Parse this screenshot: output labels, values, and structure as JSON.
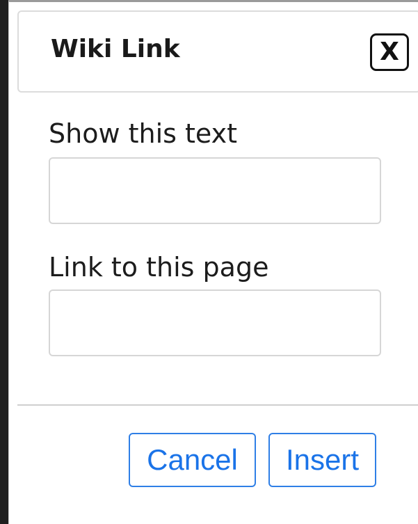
{
  "dialog": {
    "title": "Wiki Link",
    "close_label": "X"
  },
  "form": {
    "show_text_label": "Show this text",
    "show_text_value": "",
    "link_page_label": "Link to this page",
    "link_page_value": ""
  },
  "footer": {
    "cancel_label": "Cancel",
    "insert_label": "Insert"
  },
  "colors": {
    "accent": "#1a73e8",
    "border": "#d6d6d6",
    "text": "#1c1c1c"
  }
}
